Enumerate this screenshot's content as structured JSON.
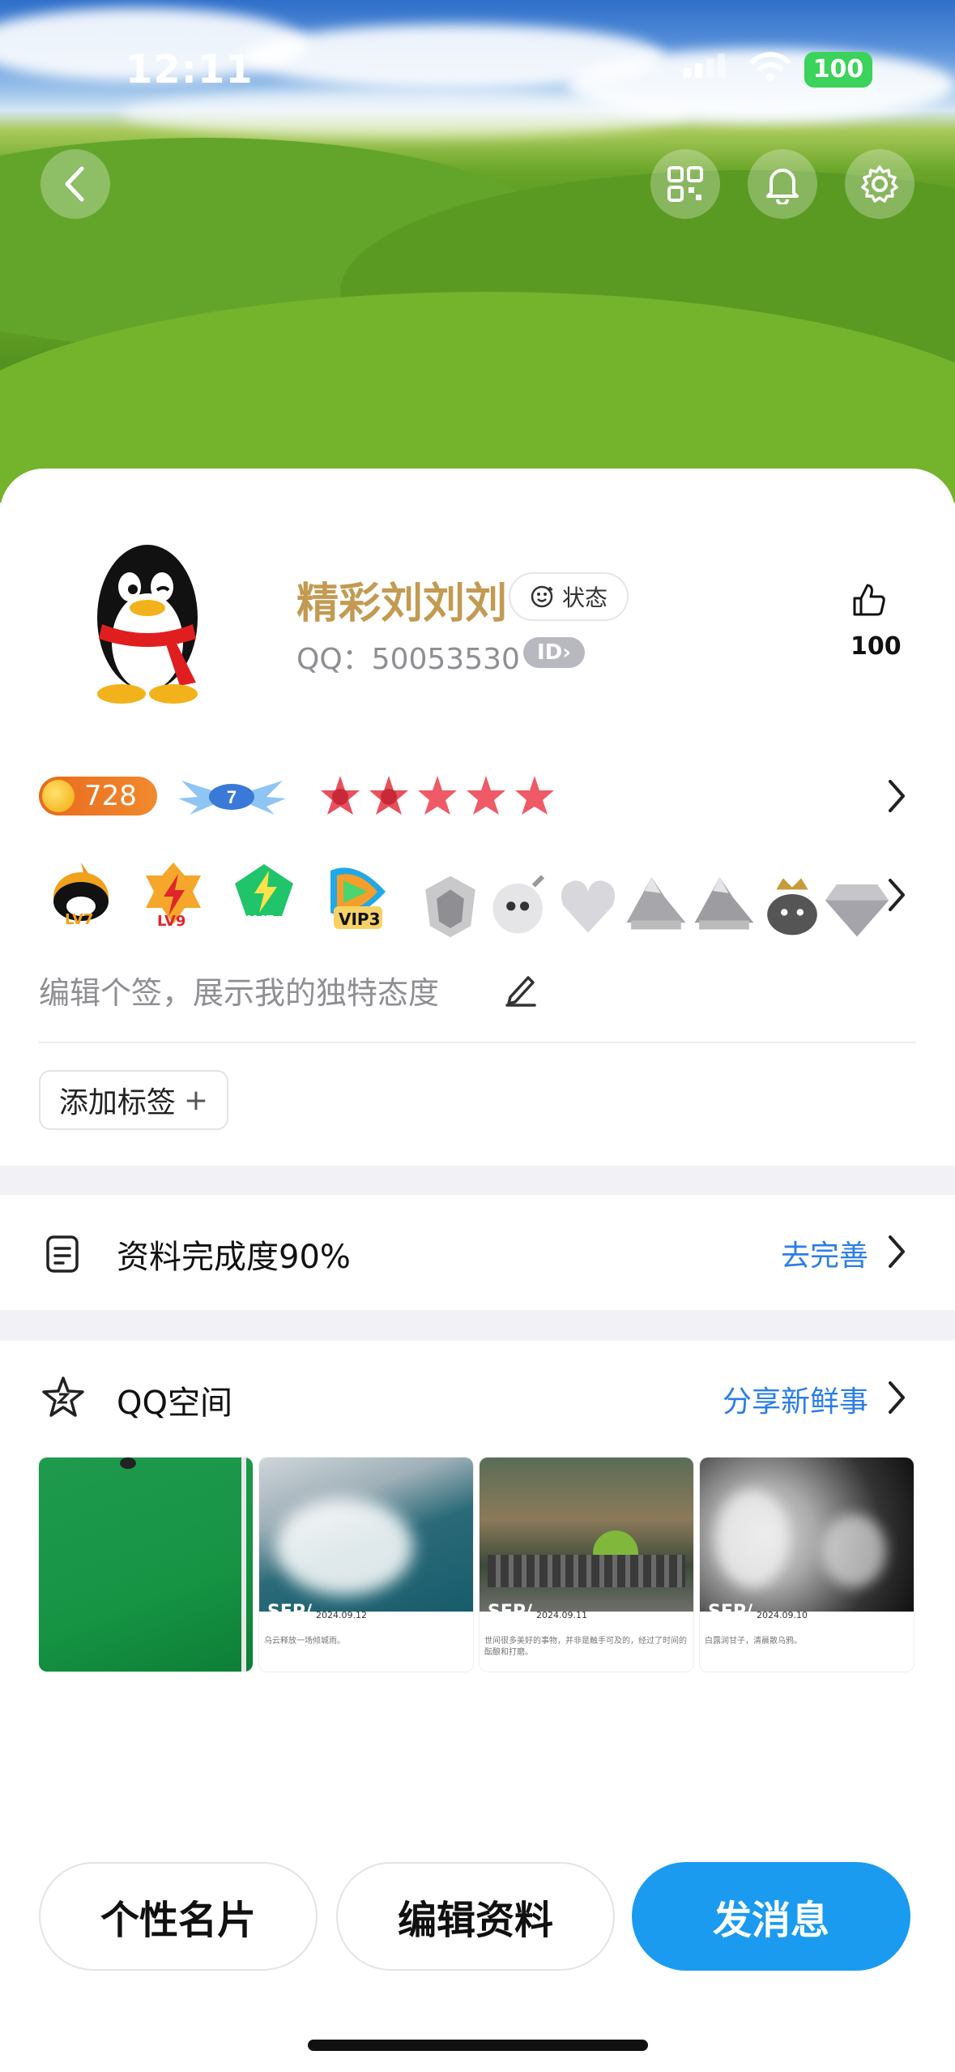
{
  "status_bar": {
    "time": "12:11",
    "battery": "100"
  },
  "header": {
    "back_icon": "chevron-left-icon",
    "qr_icon": "qr-code-icon",
    "bell_icon": "bell-icon",
    "settings_icon": "gear-icon"
  },
  "profile": {
    "name": "精彩刘刘刘",
    "status_label": "状态",
    "qq_number": "QQ：50053530",
    "id_badge": "ID",
    "likes": "100",
    "coins": "728",
    "crown_level": "7",
    "signature_placeholder": "编辑个签，展示我的独特态度",
    "add_tag_label": "添加标签",
    "badges": [
      "LV7",
      "LV9",
      "LV5",
      "VIP3"
    ]
  },
  "profile_completion": {
    "title": "资料完成度90%",
    "link": "去完善"
  },
  "qzone": {
    "title": "QQ空间",
    "link": "分享新鲜事",
    "photos": [
      {
        "sep": "",
        "date": "",
        "caption": "",
        "overlay": ""
      },
      {
        "sep": "SEP/",
        "date": "2024.09.12",
        "caption": "乌云释放一场倾城雨。",
        "overlay": "乌云释放一场倾城雨。"
      },
      {
        "sep": "SEP/",
        "date": "2024.09.11",
        "caption": "世间很多美好的事物，并非是触手可及的，经过了时间的酝酿和打磨。",
        "overlay": "世间很多美好的事物，并非是触手可及的，经过了时间的酝酿和打磨。"
      },
      {
        "sep": "SEP/",
        "date": "2024.09.10",
        "caption": "白露润甘子，清晨散乌鸦。",
        "overlay": "白露润甘子，清晨散乌鸦"
      }
    ]
  },
  "actions": {
    "card_label": "个性名片",
    "edit_label": "编辑资料",
    "message_label": "发消息"
  },
  "colors": {
    "accent": "#1a9bf0",
    "name": "#c39a52",
    "link": "#2b7de9"
  }
}
